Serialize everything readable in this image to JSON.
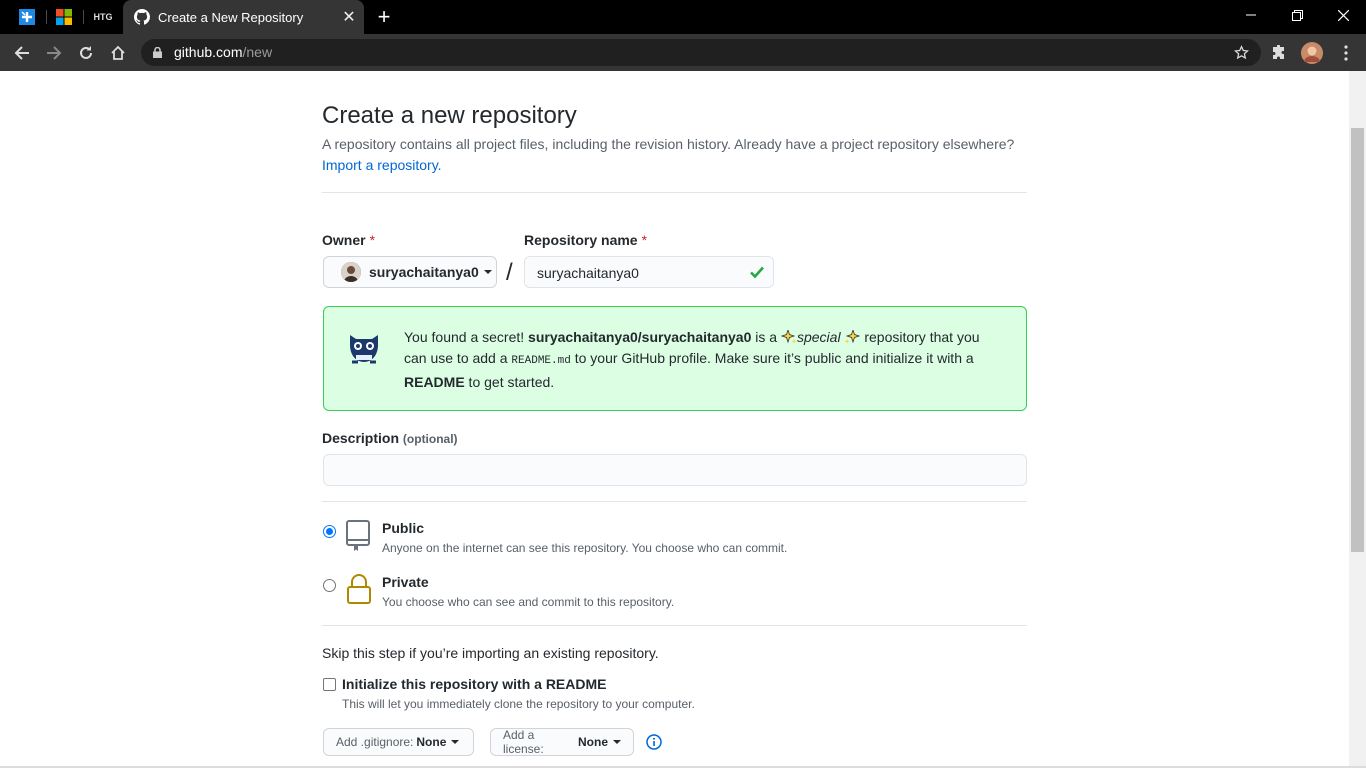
{
  "browser": {
    "tab_title": "Create a New Repository",
    "pinned": [
      "plus-app",
      "microsoft",
      "HTG"
    ],
    "url_host": "github.com",
    "url_path": "/new"
  },
  "page": {
    "title": "Create a new repository",
    "subtitle": "A repository contains all project files, including the revision history. Already have a project repository elsewhere?",
    "import_link": "Import a repository.",
    "owner_label": "Owner",
    "owner_value": "suryachaitanya0",
    "repo_label": "Repository name",
    "repo_value": "suryachaitanya0",
    "required_mark": "*",
    "slash": "/",
    "secret": {
      "p1": "You found a secret! ",
      "repo": "suryachaitanya0/suryachaitanya0",
      "p2": " is a ",
      "special": "special",
      "p3": " repository that you can use to add a ",
      "code": "README.md",
      "p4": " to your GitHub profile. Make sure it’s public and initialize it with a ",
      "readme": "README",
      "p5": " to get started."
    },
    "description_label": "Description",
    "description_optional": "(optional)",
    "public_title": "Public",
    "public_note": "Anyone on the internet can see this repository. You choose who can commit.",
    "private_title": "Private",
    "private_note": "You choose who can see and commit to this repository.",
    "skip_text": "Skip this step if you’re importing an existing repository.",
    "init_label": "Initialize this repository with a README",
    "init_note": "This will let you immediately clone the repository to your computer.",
    "gitignore_label": "Add .gitignore:",
    "gitignore_value": "None",
    "license_label": "Add a license:",
    "license_value": "None"
  },
  "colors": {
    "link": "#0366d6",
    "success": "#28a745",
    "flash_bg": "#dcffe4",
    "required": "#cb2431"
  }
}
